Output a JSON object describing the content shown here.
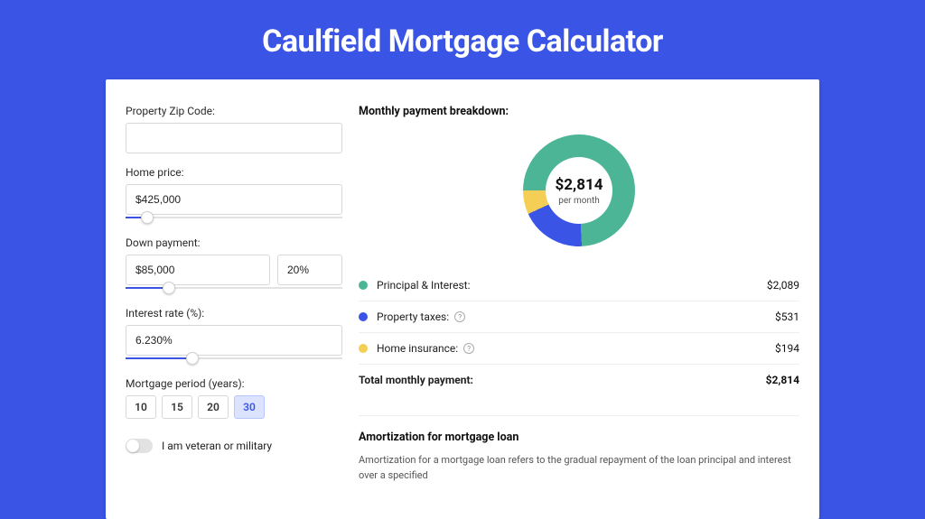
{
  "title": "Caulfield Mortgage Calculator",
  "form": {
    "zip": {
      "label": "Property Zip Code:",
      "value": ""
    },
    "home_price": {
      "label": "Home price:",
      "value": "$425,000",
      "slider_pct": 10
    },
    "down_payment": {
      "label": "Down payment:",
      "amount": "$85,000",
      "pct": "20%",
      "slider_pct": 20
    },
    "interest": {
      "label": "Interest rate (%):",
      "value": "6.230%",
      "slider_pct": 31
    },
    "period": {
      "label": "Mortgage period (years):",
      "options": [
        "10",
        "15",
        "20",
        "30"
      ],
      "active": "30"
    },
    "veteran": {
      "label": "I am veteran or military",
      "checked": false
    }
  },
  "breakdown": {
    "title": "Monthly payment breakdown:",
    "donut_amount": "$2,814",
    "donut_sub": "per month",
    "rows": [
      {
        "label": "Principal & Interest:",
        "value": "$2,089",
        "color": "#4cb595",
        "help": false
      },
      {
        "label": "Property taxes:",
        "value": "$531",
        "color": "#3a55e6",
        "help": true
      },
      {
        "label": "Home insurance:",
        "value": "$194",
        "color": "#f5cf55",
        "help": true
      }
    ],
    "total": {
      "label": "Total monthly payment:",
      "value": "$2,814"
    }
  },
  "chart_data": {
    "type": "pie",
    "title": "Monthly payment breakdown",
    "series": [
      {
        "name": "Principal & Interest",
        "value": 2089,
        "color": "#4cb595"
      },
      {
        "name": "Property taxes",
        "value": 531,
        "color": "#3a55e6"
      },
      {
        "name": "Home insurance",
        "value": 194,
        "color": "#f5cf55"
      }
    ],
    "total": 2814,
    "center_label": "$2,814",
    "center_sub": "per month"
  },
  "amort": {
    "title": "Amortization for mortgage loan",
    "text": "Amortization for a mortgage loan refers to the gradual repayment of the loan principal and interest over a specified"
  }
}
